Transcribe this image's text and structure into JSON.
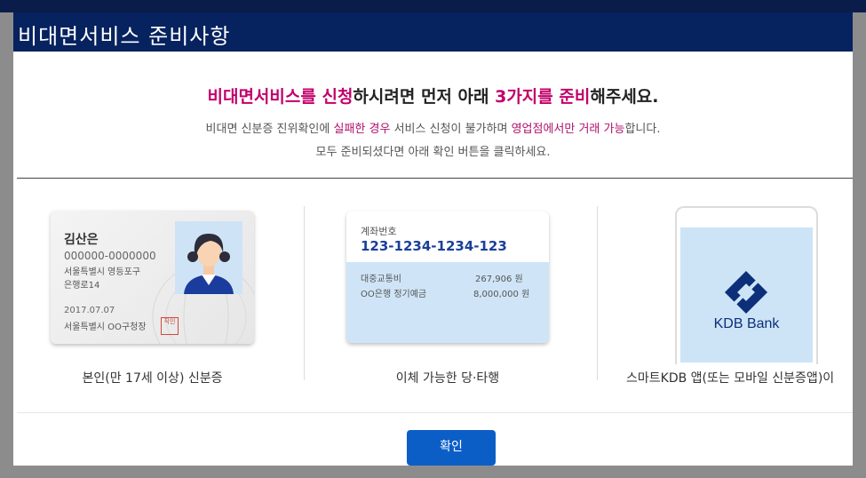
{
  "modal": {
    "title": "비대면서비스 준비사항",
    "close": "X"
  },
  "headline": {
    "part1": "비대면서비스를 신청",
    "part2": "하시려면 먼저 아래 ",
    "part3": "3가지를 준비",
    "part4": "해주세요."
  },
  "description": {
    "line1_a": "비대면 신분증 진위확인에 ",
    "line1_b": "실패한 경우",
    "line1_c": " 서비스 신청이 불가하며 ",
    "line1_d": "영업점에서만 거래 가능",
    "line1_e": "합니다.",
    "line2": "모두 준비되셨다면 아래 확인 버튼을 클릭하세요."
  },
  "items": [
    {
      "label": "본인(만 17세 이상) 신분증",
      "card": {
        "name": "김산은",
        "number": "000000-0000000",
        "address1": "서울특별시 영등포구",
        "address2": "은행로14",
        "date": "2017.07.07",
        "issuer": "서울특별시 OO구청장",
        "seal": "직인"
      }
    },
    {
      "label": "이체 가능한 당·타행",
      "card": {
        "heading": "계좌번호",
        "account": "123-1234-1234-123",
        "rows": [
          {
            "name": "대중교통비",
            "amount": "267,906 원"
          },
          {
            "name": "OO은행 정기예금",
            "amount": "8,000,000 원"
          }
        ]
      }
    },
    {
      "label": "스마트KDB 앱(또는 모바일 신분증앱)이",
      "card": {
        "brand": "KDB Bank"
      }
    }
  ],
  "confirm_label": "확인",
  "colors": {
    "header_bg": "#06225f",
    "highlight": "#c2006b",
    "button": "#0c5ec7"
  }
}
